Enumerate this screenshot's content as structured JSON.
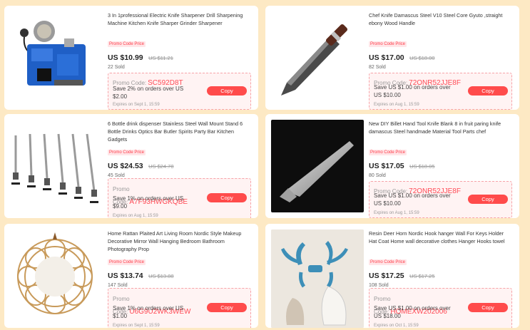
{
  "promo_label": "Promo Code Price",
  "copy_label": "Copy",
  "code_label": "Promo Code:",
  "products": [
    {
      "title": "3 In 1professional Electric Knife Sharpener Drill Sharpening Machine Kitchen Knife Sharper Grinder Sharpener",
      "price": "US $10.99",
      "old_price": "US $11.21",
      "sold": "22 Sold",
      "code": "SC592D8T",
      "condition": "Save 2% on orders over US $2.00",
      "expires": "Expires on Sept 1, 15:59",
      "image": "electric-knife-sharpener-image"
    },
    {
      "title": "Chef Knife Damascus Steel V10 Steel Core Gyuto ,straight ebony Wood Handle",
      "price": "US $17.00",
      "old_price": "US $18.00",
      "sold": "82 Sold",
      "code": "72ONR52JJE8F",
      "condition": "Save US $1.00 on orders over US $10.00",
      "expires": "Expires on Aug 1, 15:59",
      "image": "damascus-chef-knife-image"
    },
    {
      "title": "6 Bottle drink dispenser Stainless Steel Wall Mount Stand 6 Bottle Drinks Optics Bar Butler Spirits Party Bar Kitchen Gadgets",
      "price": "US $24.53",
      "old_price": "US $24.78",
      "sold": "45 Sold",
      "code": "A7F93HWGKQBE",
      "condition": "Save 1% on orders over US $9.00",
      "expires": "Expires on Aug 1, 15:59",
      "image": "bottle-dispenser-image"
    },
    {
      "title": "New DIY Billet Hand Tool Knife Blank 8 in fruit paring knife damascus Steel handmade Material Tool Parts chef",
      "price": "US $17.05",
      "old_price": "US $18.05",
      "sold": "80 Sold",
      "code": "72ONR52JJE8F",
      "condition": "Save US $1.00 on orders over US $10.00",
      "expires": "Expires on Aug 1, 15:59",
      "image": "knife-blank-image"
    },
    {
      "title": "Home Rattan Plaited Art Living Room Nordic Style Makeup Decorative Mirror Wall Hanging Bedroom Bathroom Photography Prop",
      "price": "US $13.74",
      "old_price": "US $13.88",
      "sold": "147 Sold",
      "code": "U6G9U2WK3WEW",
      "condition": "Save 1% on orders over US $1.00",
      "expires": "Expires on Sept 1, 15:59",
      "image": "rattan-mirror-image"
    },
    {
      "title": "Resin Deer Horn Nordic Hook hanger Wall For Keys Holder Hat Coat Home wall decorative clothes Hanger Hooks towel",
      "price": "US $17.25",
      "old_price": "US $17.25",
      "sold": "108 Sold",
      "code": "HOMEXW202006",
      "condition": "Save US $1.00 on orders over US $18.00",
      "expires": "Expires on Oct 1, 15:59",
      "image": "deer-horn-hook-image"
    }
  ]
}
